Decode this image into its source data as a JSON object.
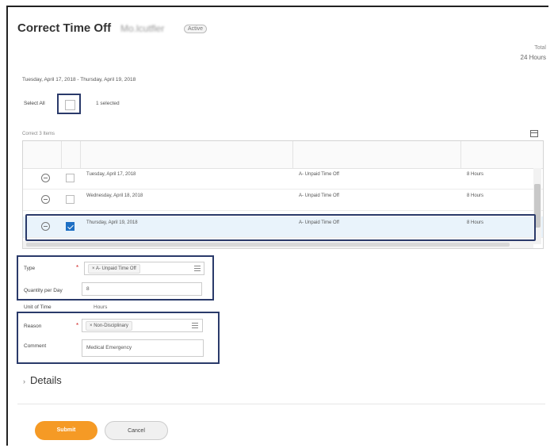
{
  "header": {
    "title": "Correct Time Off",
    "person_name": "Mo.lcutfler",
    "badge": "Active",
    "total_label": "Total",
    "total_value": "24 Hours"
  },
  "date_range": "Tuesday, April 17, 2018 - Thursday, April 19, 2018",
  "select_all": {
    "label": "Select All",
    "count": "1 selected"
  },
  "correct": {
    "label": "Correct  3 Items"
  },
  "rows": [
    {
      "date": "Tuesday, April 17, 2018",
      "type": "A- Unpaid Time Off",
      "qty": "8 Hours",
      "checked": false
    },
    {
      "date": "Wednesday, April 18, 2018",
      "type": "A- Unpaid Time Off",
      "qty": "8 Hours",
      "checked": false
    },
    {
      "date": "Thursday, April 19, 2018",
      "type": "A- Unpaid Time Off",
      "qty": "8 Hours",
      "checked": true
    }
  ],
  "form": {
    "type_label": "Type",
    "type_value": "A- Unpaid Time Off",
    "qty_label": "Quantity per Day",
    "qty_value": "8",
    "unit_label": "Unit of Time",
    "unit_value": "Hours",
    "reason_label": "Reason",
    "reason_value": "Non-Disciplinary",
    "comment_label": "Comment",
    "comment_value": "Medical Emergency",
    "required_mark": "*",
    "remove_mark": "×"
  },
  "details_label": "Details",
  "buttons": {
    "submit": "Submit",
    "cancel": "Cancel"
  },
  "colors": {
    "accent": "#f59a25",
    "highlight_border": "#2a3a6a",
    "checkbox_on": "#1e6fc4"
  }
}
